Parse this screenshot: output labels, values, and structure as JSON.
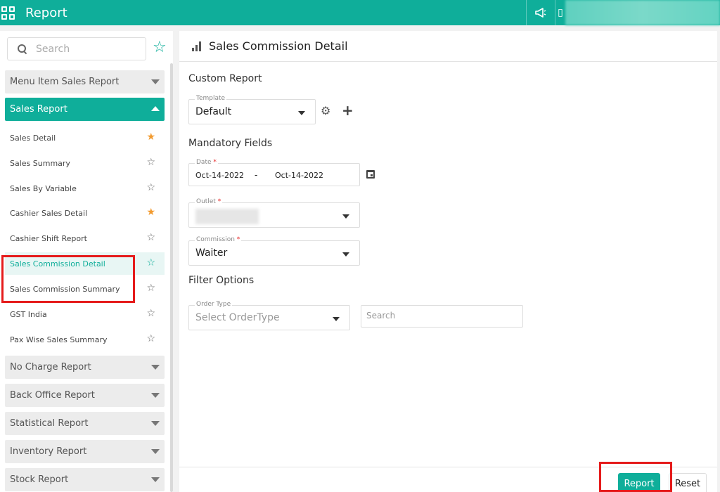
{
  "app": {
    "title": "Report"
  },
  "sidebar": {
    "search_placeholder": "Search",
    "groups_top": [
      {
        "label": "Menu Item Sales Report",
        "active": false
      },
      {
        "label": "Sales Report",
        "active": true
      }
    ],
    "items": [
      {
        "label": "Sales Detail",
        "starred": true
      },
      {
        "label": "Sales Summary",
        "starred": false
      },
      {
        "label": "Sales By Variable",
        "starred": false
      },
      {
        "label": "Cashier Sales Detail",
        "starred": true
      },
      {
        "label": "Cashier Shift Report",
        "starred": false
      },
      {
        "label": "Sales Commission Detail",
        "starred": false,
        "selected": true
      },
      {
        "label": "Sales Commission Summary",
        "starred": false
      },
      {
        "label": "GST India",
        "starred": false
      },
      {
        "label": "Pax Wise Sales Summary",
        "starred": false
      }
    ],
    "groups_bottom": [
      {
        "label": "No Charge Report"
      },
      {
        "label": "Back Office Report"
      },
      {
        "label": "Statistical Report"
      },
      {
        "label": "Inventory Report"
      },
      {
        "label": "Stock Report"
      }
    ]
  },
  "main": {
    "title": "Sales Commission Detail",
    "custom_report": {
      "section_title": "Custom Report",
      "template_label": "Template",
      "template_value": "Default"
    },
    "mandatory": {
      "section_title": "Mandatory Fields",
      "date_label": "Date",
      "date_from": "Oct-14-2022",
      "date_sep": "-",
      "date_to": "Oct-14-2022",
      "outlet_label": "Outlet",
      "commission_label": "Commission",
      "commission_value": "Waiter"
    },
    "filter": {
      "section_title": "Filter Options",
      "order_type_label": "Order Type",
      "order_type_placeholder": "Select OrderType",
      "search_placeholder": "Search"
    },
    "footer": {
      "report_label": "Report",
      "reset_label": "Reset"
    }
  },
  "colors": {
    "accent": "#0fae9a",
    "star_filled": "#f29a2e",
    "highlight": "#e51b1b"
  }
}
